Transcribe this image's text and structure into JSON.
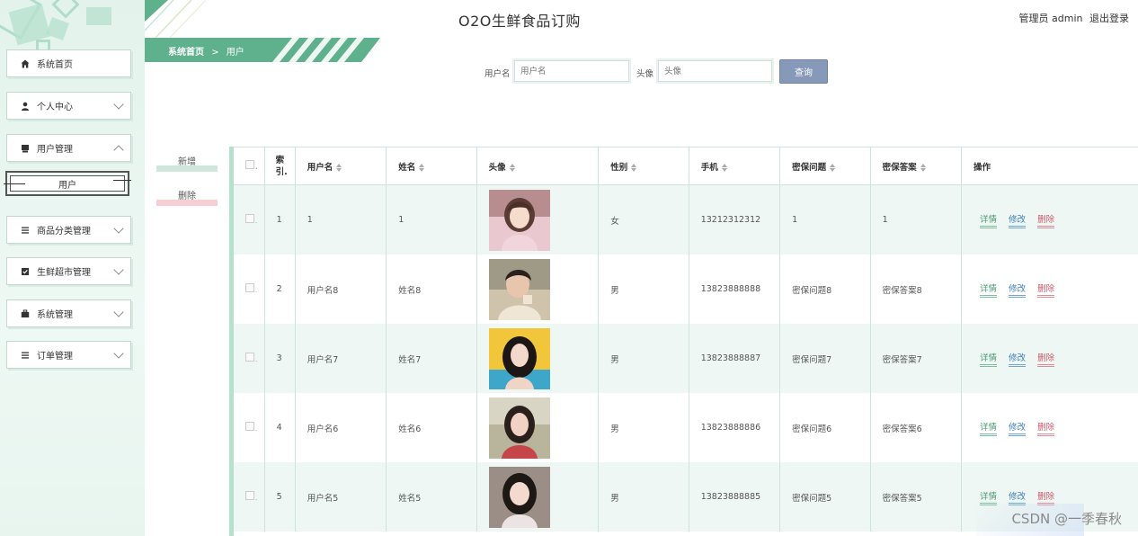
{
  "header": {
    "title": "O2O生鲜食品订购",
    "user_text": "管理员 admin",
    "logout": "退出登录"
  },
  "breadcrumb": {
    "home": "系统首页",
    "sep": ">",
    "current": "用户"
  },
  "sidebar": {
    "items": [
      {
        "label": "系统首页",
        "icon": "home-icon"
      },
      {
        "label": "个人中心",
        "icon": "person-icon"
      },
      {
        "label": "用户管理",
        "icon": "user-manage-icon"
      },
      {
        "label": "商品分类管理",
        "icon": "list-icon"
      },
      {
        "label": "生鲜超市管理",
        "icon": "check-icon"
      },
      {
        "label": "系统管理",
        "icon": "briefcase-icon"
      },
      {
        "label": "订单管理",
        "icon": "list-icon"
      }
    ],
    "submenu": {
      "label": "用户"
    }
  },
  "search": {
    "username_label": "用户名",
    "username_placeholder": "用户名",
    "avatar_label": "头像",
    "avatar_placeholder": "头像",
    "query_button": "查询"
  },
  "actions": {
    "add": "新增",
    "delete": "删除"
  },
  "table": {
    "headers": {
      "index": "索引.",
      "username": "用户名",
      "name": "姓名",
      "avatar": "头像",
      "gender": "性别",
      "phone": "手机",
      "question": "密保问题",
      "answer": "密保答案",
      "ops": "操作"
    },
    "ops": {
      "detail": "详情",
      "edit": "修改",
      "remove": "删除"
    },
    "rows": [
      {
        "index": "1",
        "username": "1",
        "name": "1",
        "gender": "女",
        "phone": "13212312312",
        "question": "1",
        "answer": "1"
      },
      {
        "index": "2",
        "username": "用户名8",
        "name": "姓名8",
        "gender": "男",
        "phone": "13823888888",
        "question": "密保问题8",
        "answer": "密保答案8"
      },
      {
        "index": "3",
        "username": "用户名7",
        "name": "姓名7",
        "gender": "男",
        "phone": "13823888887",
        "question": "密保问题7",
        "answer": "密保答案7"
      },
      {
        "index": "4",
        "username": "用户名6",
        "name": "姓名6",
        "gender": "男",
        "phone": "13823888886",
        "question": "密保问题6",
        "answer": "密保答案6"
      },
      {
        "index": "5",
        "username": "用户名5",
        "name": "姓名5",
        "gender": "男",
        "phone": "13823888885",
        "question": "密保问题5",
        "answer": "密保答案5"
      }
    ]
  },
  "watermark": "CSDN @一季春秋",
  "colors": {
    "theme_green": "#5fb08d",
    "query_button": "#8799b9",
    "detail": "#4c9b73",
    "edit": "#3f7fb5",
    "remove": "#c95a6a"
  }
}
